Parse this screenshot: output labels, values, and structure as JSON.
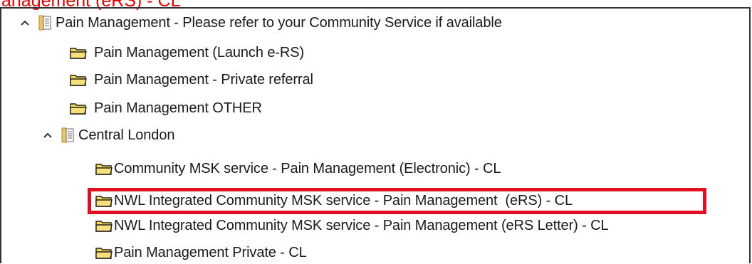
{
  "caption": "anagement (eRS) - CL",
  "tree": {
    "root": {
      "label": "Pain Management - Please refer to your Community Service if available",
      "expanded": true
    },
    "root_children": [
      {
        "label": "Pain Management (Launch e-RS)"
      },
      {
        "label": "Pain Management - Private referral"
      },
      {
        "label": "Pain Management OTHER"
      }
    ],
    "subgroup": {
      "label": "Central London",
      "expanded": true
    },
    "subgroup_children": [
      {
        "label": "Community MSK service - Pain Management (Electronic) - CL"
      },
      {
        "label": "NWL Integrated Community MSK service - Pain Management  (eRS) - CL",
        "highlighted": true
      },
      {
        "label": "NWL Integrated Community MSK service - Pain Management (eRS Letter) - CL"
      },
      {
        "label": "Pain Management Private - CL"
      }
    ]
  },
  "colors": {
    "highlight": "#e01020",
    "caption": "#e00000",
    "folder": "#f5d94a"
  },
  "icons": {
    "expanded": "chevron-up-icon",
    "book": "book-icon",
    "folder": "folder-icon"
  }
}
